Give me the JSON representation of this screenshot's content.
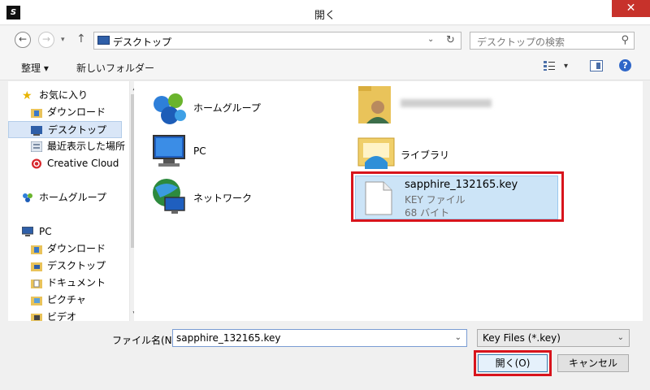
{
  "window": {
    "title": "開く",
    "app_icon": "adobe-s",
    "close_label": "✕"
  },
  "address": {
    "path": "デスクトップ",
    "search_placeholder": "デスクトップの検索"
  },
  "toolbar": {
    "organize": "整理 ▾",
    "new_folder": "新しいフォルダー"
  },
  "nav": {
    "items": [
      {
        "label": "お気に入り",
        "icon": "star-icon"
      },
      {
        "label": "ダウンロード",
        "icon": "download-folder-icon"
      },
      {
        "label": "デスクトップ",
        "icon": "desktop-icon",
        "selected": true
      },
      {
        "label": "最近表示した場所",
        "icon": "recent-places-icon"
      },
      {
        "label": "Creative Cloud",
        "icon": "creative-cloud-icon"
      },
      {
        "label": "ホームグループ",
        "icon": "homegroup-icon"
      },
      {
        "label": "PC",
        "icon": "pc-icon"
      },
      {
        "label": "ダウンロード",
        "icon": "download-folder-icon"
      },
      {
        "label": "デスクトップ",
        "icon": "desktop-folder-icon"
      },
      {
        "label": "ドキュメント",
        "icon": "documents-icon"
      },
      {
        "label": "ピクチャ",
        "icon": "pictures-icon"
      },
      {
        "label": "ビデオ",
        "icon": "videos-icon"
      }
    ]
  },
  "content": {
    "items": [
      {
        "label": "ホームグループ",
        "icon": "homegroup-icon"
      },
      {
        "label": "PC",
        "icon": "pc-icon"
      },
      {
        "label": "ネットワーク",
        "icon": "network-icon"
      },
      {
        "label": "",
        "icon": "user-folder-icon"
      },
      {
        "label": "ライブラリ",
        "icon": "libraries-icon"
      }
    ],
    "selected_file": {
      "name": "sapphire_132165.key",
      "type": "KEY ファイル",
      "size": "68 バイト",
      "icon": "blank-file-icon"
    }
  },
  "bottom": {
    "filename_label": "ファイル名(N):",
    "filename_value": "sapphire_132165.key",
    "filter_value": "Key Files (*.key)",
    "open_label": "開く(O)",
    "cancel_label": "キャンセル"
  },
  "colors": {
    "highlight_red": "#d8141c",
    "selection_blue": "#cce4f7",
    "close_red": "#c7322b"
  }
}
